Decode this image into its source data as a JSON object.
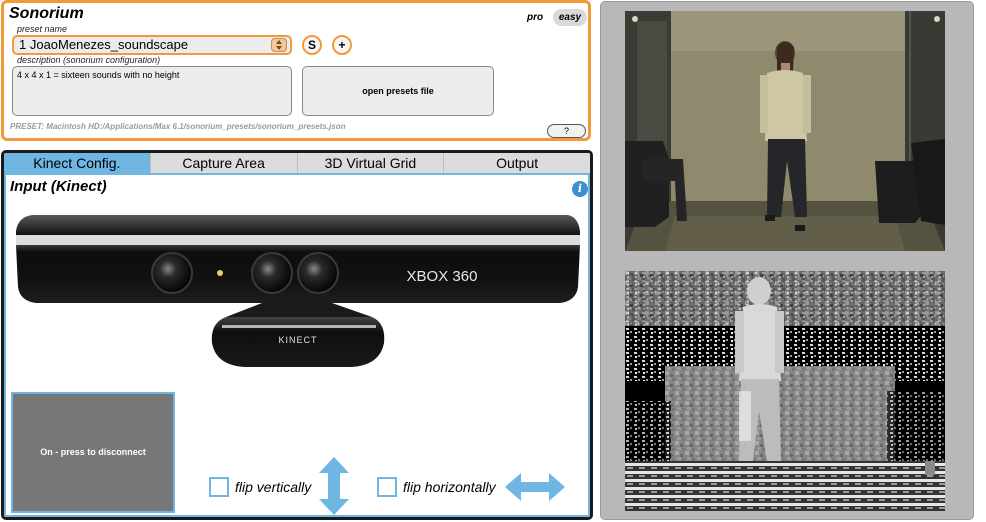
{
  "app": {
    "title": "Sonorium"
  },
  "modes": {
    "pro": "pro",
    "easy": "easy",
    "active": "easy"
  },
  "preset": {
    "name_label": "preset name",
    "selected": "1 JoaoMenezes_soundscape",
    "save_button": "S",
    "add_button": "+",
    "description_label": "description (sonorium configuration)",
    "description": "4 x 4 x 1 = sixteen sounds with no height",
    "open_presets": "open presets file",
    "path": "PRESET: Macintosh HD:/Applications/Max 6.1/sonorium_presets/sonorium_presets.json",
    "help_button": "?"
  },
  "tabs": [
    {
      "label": "Kinect Config.",
      "active": true
    },
    {
      "label": "Capture Area",
      "active": false
    },
    {
      "label": "3D Virtual Grid",
      "active": false
    },
    {
      "label": "Output",
      "active": false
    }
  ],
  "kinect": {
    "section_title": "Input (Kinect)",
    "info_icon": "i",
    "device_brand": "XBOX 360",
    "device_name": "KINECT",
    "connect_button": "On - press to disconnect",
    "flip_vertical_label": "flip vertically",
    "flip_vertical_checked": false,
    "flip_horizontal_label": "flip horizontally",
    "flip_horizontal_checked": false
  },
  "icons": {
    "info": "info-icon",
    "stepper": "up-down-stepper-icon",
    "vertical_arrow": "vertical-double-arrow-icon",
    "horizontal_arrow": "horizontal-double-arrow-icon"
  },
  "colors": {
    "accent_orange": "#f29a3a",
    "accent_blue": "#6fb6e2",
    "tab_active": "#6fb6e2",
    "connect_button": "#777777",
    "video_panel_bg": "#b8b8b8"
  }
}
